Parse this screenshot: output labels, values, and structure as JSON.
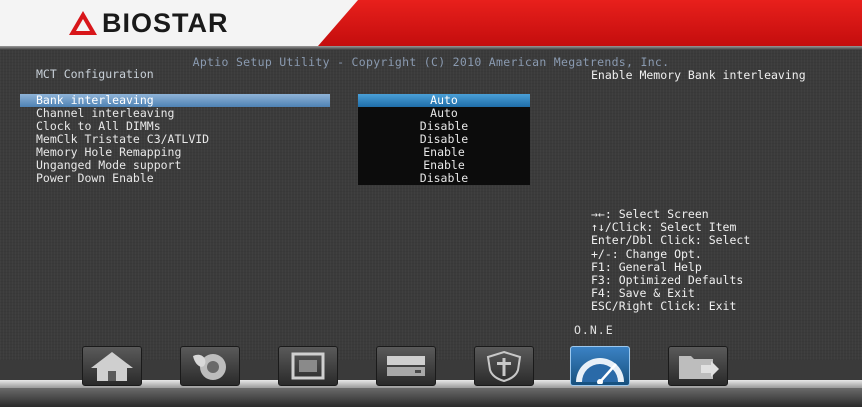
{
  "brand": {
    "logo_text": "BIOSTAR",
    "colors": {
      "banner_red": "#d8161a",
      "selected_blue": "#3a7ec0",
      "text_blue": "#8a9ab0"
    }
  },
  "header": {
    "utility_title": "Aptio Setup Utility - Copyright (C) 2010 American Megatrends, Inc.",
    "page_title": "MCT Configuration",
    "help_text": "Enable Memory Bank interleaving"
  },
  "settings": [
    {
      "label": "Bank interleaving",
      "value": "Auto",
      "selected": true
    },
    {
      "label": "Channel interleaving",
      "value": "Auto",
      "selected": false
    },
    {
      "label": "Clock to All DIMMs",
      "value": "Disable",
      "selected": false
    },
    {
      "label": "MemClk Tristate C3/ATLVID",
      "value": "Disable",
      "selected": false
    },
    {
      "label": "Memory Hole Remapping",
      "value": "Enable",
      "selected": false
    },
    {
      "label": "Unganged Mode support",
      "value": "Enable",
      "selected": false
    },
    {
      "label": "Power Down Enable",
      "value": "Disable",
      "selected": false
    }
  ],
  "keys": [
    "→←: Select Screen",
    "↑↓/Click: Select Item",
    "Enter/Dbl Click: Select",
    "+/-: Change Opt.",
    "F1: General Help",
    "F3: Optimized Defaults",
    "F4: Save & Exit",
    "ESC/Right Click: Exit"
  ],
  "footer_label": "O.N.E",
  "tabs": [
    {
      "icon": "home-icon",
      "active": false
    },
    {
      "icon": "advanced-icon",
      "active": false
    },
    {
      "icon": "chipset-icon",
      "active": false
    },
    {
      "icon": "boot-icon",
      "active": false
    },
    {
      "icon": "security-icon",
      "active": false
    },
    {
      "icon": "one-overclock-icon",
      "active": true
    },
    {
      "icon": "save-exit-icon",
      "active": false
    }
  ]
}
